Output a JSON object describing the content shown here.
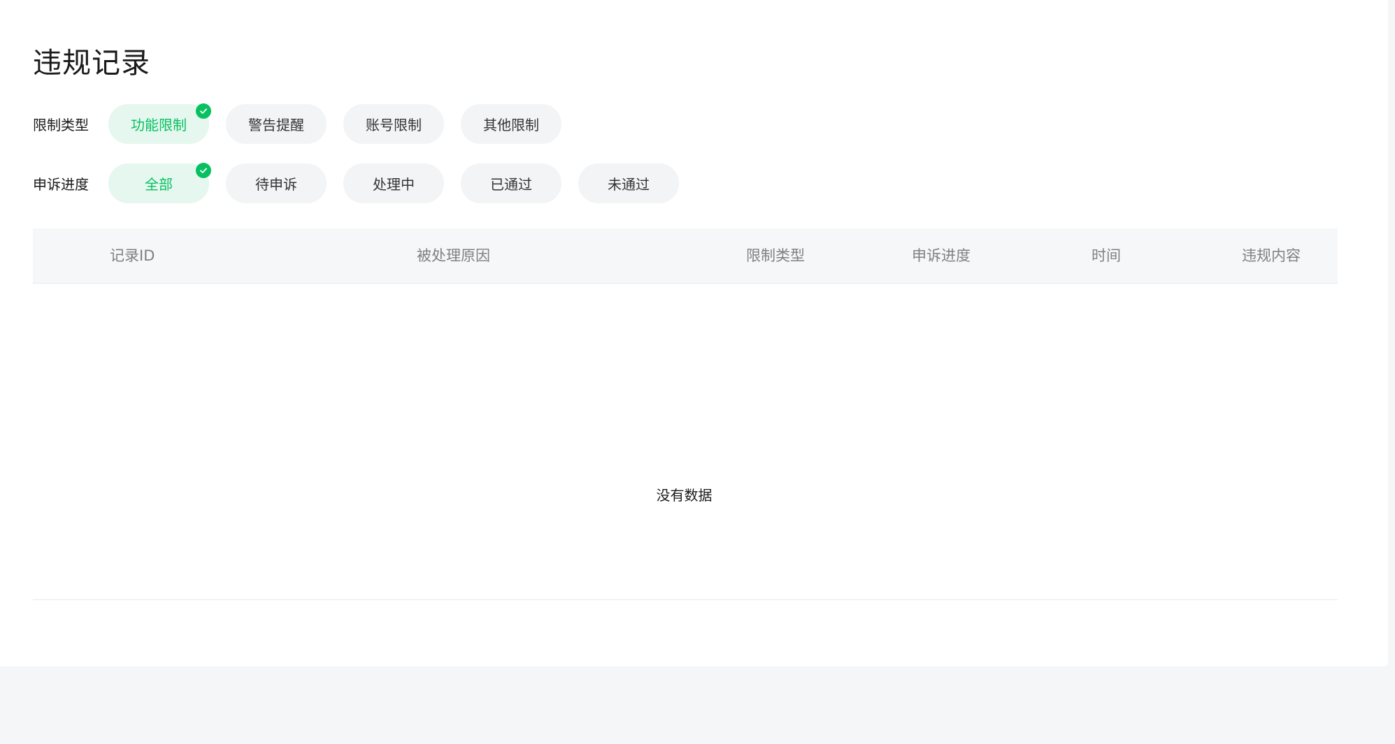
{
  "page": {
    "title": "违规记录"
  },
  "filters": {
    "restriction": {
      "label": "限制类型",
      "options": [
        "功能限制",
        "警告提醒",
        "账号限制",
        "其他限制"
      ],
      "selected": "功能限制"
    },
    "appeal": {
      "label": "申诉进度",
      "options": [
        "全部",
        "待申诉",
        "处理中",
        "已通过",
        "未通过"
      ],
      "selected": "全部"
    }
  },
  "table": {
    "columns": [
      "记录ID",
      "被处理原因",
      "限制类型",
      "申诉进度",
      "时间",
      "违规内容"
    ],
    "rows": [],
    "empty_text": "没有数据"
  },
  "colors": {
    "accent": "#07c160",
    "chip_active_bg": "#e5f7ef",
    "chip_bg": "#f3f4f5",
    "header_bg": "#f6f7f8"
  },
  "icons": {
    "selected_badge": "check-icon"
  }
}
